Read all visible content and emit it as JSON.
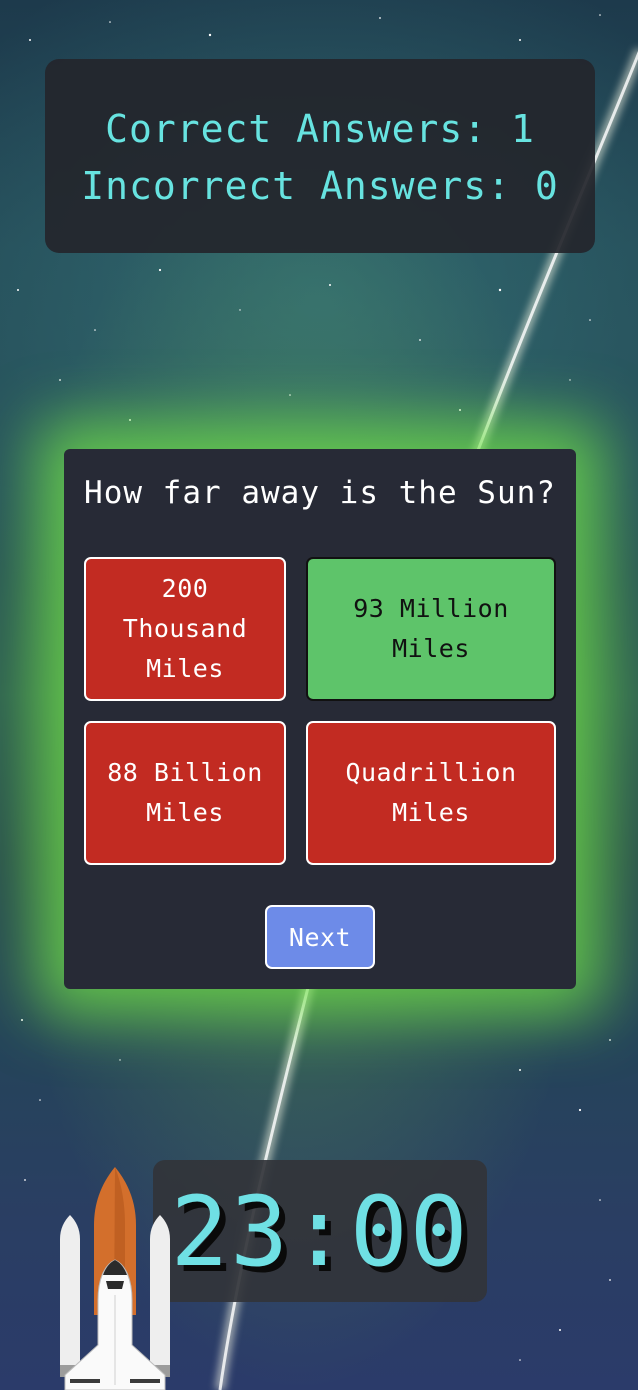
{
  "scoreboard": {
    "correct_text": "Correct Answers: 1",
    "incorrect_text": "Incorrect Answers: 0"
  },
  "quiz": {
    "question": "How far away is the Sun?",
    "answers": [
      {
        "text": "200 Thousand Miles",
        "state": "incorrect"
      },
      {
        "text": "93 Million Miles",
        "state": "correct"
      },
      {
        "text": "88 Billion Miles",
        "state": "incorrect"
      },
      {
        "text": "Quadrillion Miles",
        "state": "incorrect"
      }
    ],
    "next_label": "Next"
  },
  "timer": {
    "value": "23:00"
  },
  "colors": {
    "accent_cyan": "#67e3e0",
    "correct_green": "#5ec46a",
    "incorrect_red": "#c22b22",
    "next_blue": "#6d8be8",
    "card_glow": "#72e448"
  },
  "icons": {
    "mascot": "space-shuttle-icon"
  }
}
